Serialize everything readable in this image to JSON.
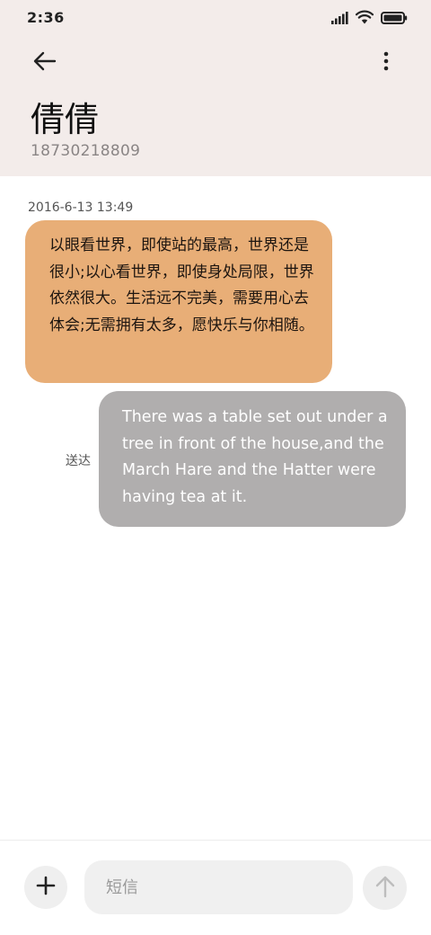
{
  "status_bar": {
    "time": "2:36",
    "icons": [
      "signal-icon",
      "wifi-icon",
      "battery-icon"
    ]
  },
  "header": {
    "back_icon": "back-arrow-icon",
    "more_icon": "more-vertical-icon",
    "contact_name": "倩倩",
    "contact_number": "18730218809",
    "background_color": "#f3ecea"
  },
  "conversation": {
    "timestamp": "2016-6-13 13:49",
    "incoming": {
      "text": "以眼看世界，即使站的最高，世界还是很小;以心看世界，即使身处局限，世界依然很大。生活远不完美，需要用心去体会;无需拥有太多，愿快乐与你相随。",
      "color": "#e8ae77"
    },
    "outgoing": {
      "text": "There was a table set out under a tree in front of the house,and the March Hare and the Hatter were having tea at it.",
      "status": "送达",
      "color": "#b0aeae"
    }
  },
  "composer": {
    "add_icon": "plus-icon",
    "input_placeholder": "短信",
    "input_value": "",
    "send_icon": "send-arrow-up-icon"
  }
}
